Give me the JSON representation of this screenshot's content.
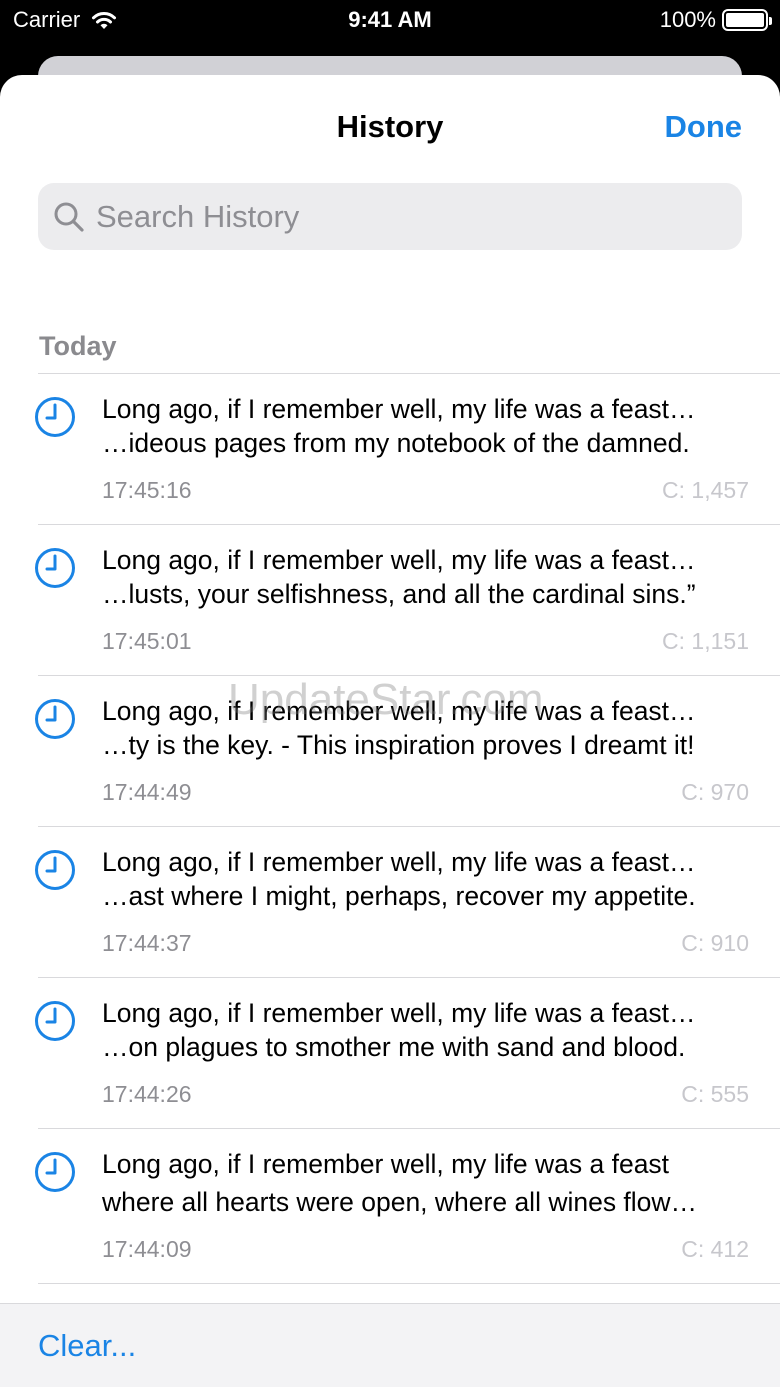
{
  "status_bar": {
    "carrier": "Carrier",
    "time": "9:41 AM",
    "battery": "100%"
  },
  "nav": {
    "title": "History",
    "done_label": "Done"
  },
  "search": {
    "placeholder": "Search History",
    "value": ""
  },
  "section": {
    "title": "Today"
  },
  "history": [
    {
      "line1": "Long ago, if I remember well, my life was a feast…",
      "line2": "…ideous pages from my notebook of the damned.",
      "time": "17:45:16",
      "count": "C: 1,457"
    },
    {
      "line1": "Long ago, if I remember well, my life was a feast…",
      "line2": "…lusts, your selfishness, and all the cardinal sins.”",
      "time": "17:45:01",
      "count": "C: 1,151"
    },
    {
      "line1": "Long ago, if I remember well, my life was a feast…",
      "line2": "…ty is the key. - This inspiration proves I dreamt it!",
      "time": "17:44:49",
      "count": "C: 970"
    },
    {
      "line1": "Long ago, if I remember well, my life was a feast…",
      "line2": "…ast where I might, perhaps, recover my appetite.",
      "time": "17:44:37",
      "count": "C: 910"
    },
    {
      "line1": "Long ago, if I remember well, my life was a feast…",
      "line2": "…on plagues to smother me with sand and blood.",
      "time": "17:44:26",
      "count": "C: 555"
    },
    {
      "line1": "Long ago, if I remember well, my life was a feast",
      "line2": "where all hearts were open, where all wines flow…",
      "time": "17:44:09",
      "count": "C: 412"
    }
  ],
  "watermark": "UpdateStar.com",
  "toolbar": {
    "clear_label": "Clear..."
  },
  "colors": {
    "accent": "#1a84e5",
    "secondary_text": "#8e8e93",
    "count_text": "#c7c7cc"
  },
  "icons": {
    "history_row": "clock-icon",
    "search": "search-icon",
    "wifi": "wifi-icon",
    "battery": "battery-icon"
  }
}
